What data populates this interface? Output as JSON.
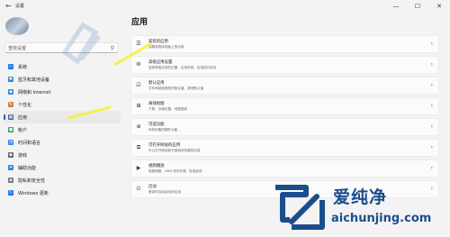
{
  "window": {
    "title": "设置",
    "back": "←",
    "minimize": "—",
    "maximize": "☐",
    "close": "✕"
  },
  "search": {
    "placeholder": "查找设置",
    "icon": "search-icon"
  },
  "sidebar": {
    "items": [
      {
        "label": "系统",
        "color": "#1a73e8",
        "glyph": "▭"
      },
      {
        "label": "蓝牙和其他设备",
        "color": "#2e86de",
        "glyph": "✱"
      },
      {
        "label": "网络和 Internet",
        "color": "#2e86de",
        "glyph": "◆"
      },
      {
        "label": "个性化",
        "color": "#d1843b",
        "glyph": "✎"
      },
      {
        "label": "应用",
        "color": "#4a5f7a",
        "glyph": "▦",
        "active": true
      },
      {
        "label": "帐户",
        "color": "#2e9d5c",
        "glyph": "●"
      },
      {
        "label": "时间和语言",
        "color": "#2e86de",
        "glyph": "◔"
      },
      {
        "label": "游戏",
        "color": "#5a6270",
        "glyph": "◉"
      },
      {
        "label": "辅助功能",
        "color": "#2e86de",
        "glyph": "✦"
      },
      {
        "label": "隐私和安全性",
        "color": "#6b7685",
        "glyph": "◈"
      },
      {
        "label": "Windows 更新",
        "color": "#1a73e8",
        "glyph": "↻"
      }
    ]
  },
  "main": {
    "title": "应用",
    "cards": [
      {
        "title": "安装的应用",
        "subtitle": "卸载和排序电脑上的应用",
        "icon": "☰"
      },
      {
        "title": "高级应用设置",
        "subtitle": "选择获取应用的位置、应用存档、应用执行别名",
        "icon": "⚙"
      },
      {
        "title": "默认应用",
        "subtitle": "文件和链接类型的默认值、其他默认值",
        "icon": "☑"
      },
      {
        "title": "离线地图",
        "subtitle": "下载、存储位置、地图更新",
        "icon": "⊞"
      },
      {
        "title": "可选功能",
        "subtitle": "你的设备的额外功能",
        "icon": "⊕"
      },
      {
        "title": "可打开网站的应用",
        "subtitle": "可以打开网站而不使用浏览器的应用",
        "icon": "⧉"
      },
      {
        "title": "视频播放",
        "subtitle": "视频调整、HDR 流式处理、电池选项",
        "icon": "▶"
      },
      {
        "title": "启动",
        "subtitle": "登录时自动启动的应用",
        "icon": "⏻"
      }
    ],
    "chevron": "›"
  },
  "watermark": {
    "name": "爱纯净",
    "url": "aichunjing.com",
    "color": "#1b4d8c"
  }
}
